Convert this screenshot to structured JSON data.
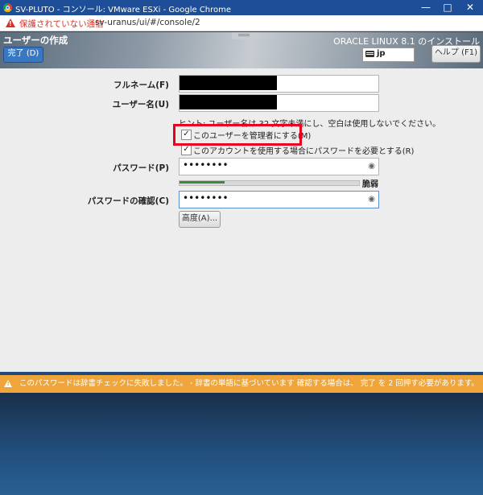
{
  "window": {
    "title": "SV-PLUTO - コンソール: VMware ESXi - Google Chrome"
  },
  "address_bar": {
    "security_text": "保護されていない通信",
    "url": "sv-uranus/ui/#/console/2"
  },
  "header": {
    "heading": "ユーザーの作成",
    "subtitle": "ORACLE LINUX 8.1 のインストール",
    "done_label": "完了 (D)",
    "keyboard_layout": "jp",
    "help_label": "ヘルプ (F1)"
  },
  "form": {
    "fullname_label": "フルネーム(F)",
    "username_label": "ユーザー名(U)",
    "hint": "ヒント: ユーザー名は 32 文字未満にし、空白は使用しないでください。",
    "admin_checkbox_label": "このユーザーを管理者にする(M)",
    "admin_checked": true,
    "require_password_label": "このアカウントを使用する場合にパスワードを必要とする(R)",
    "require_password_checked": true,
    "password_label": "パスワード(P)",
    "password_value": "••••••••",
    "strength_label": "脆弱",
    "strength_fraction": 0.25,
    "confirm_label": "パスワードの確認(C)",
    "confirm_value": "••••••••",
    "advanced_label": "高度(A)..."
  },
  "warning": {
    "message": "このパスワードは辞書チェックに失敗しました。 - 辞書の単語に基づいています 確認する場合は、 完了 を 2 回押す必要があります。"
  },
  "colors": {
    "accent": "#3878c2",
    "warning": "#f0a53a",
    "highlight": "#e8001c"
  }
}
